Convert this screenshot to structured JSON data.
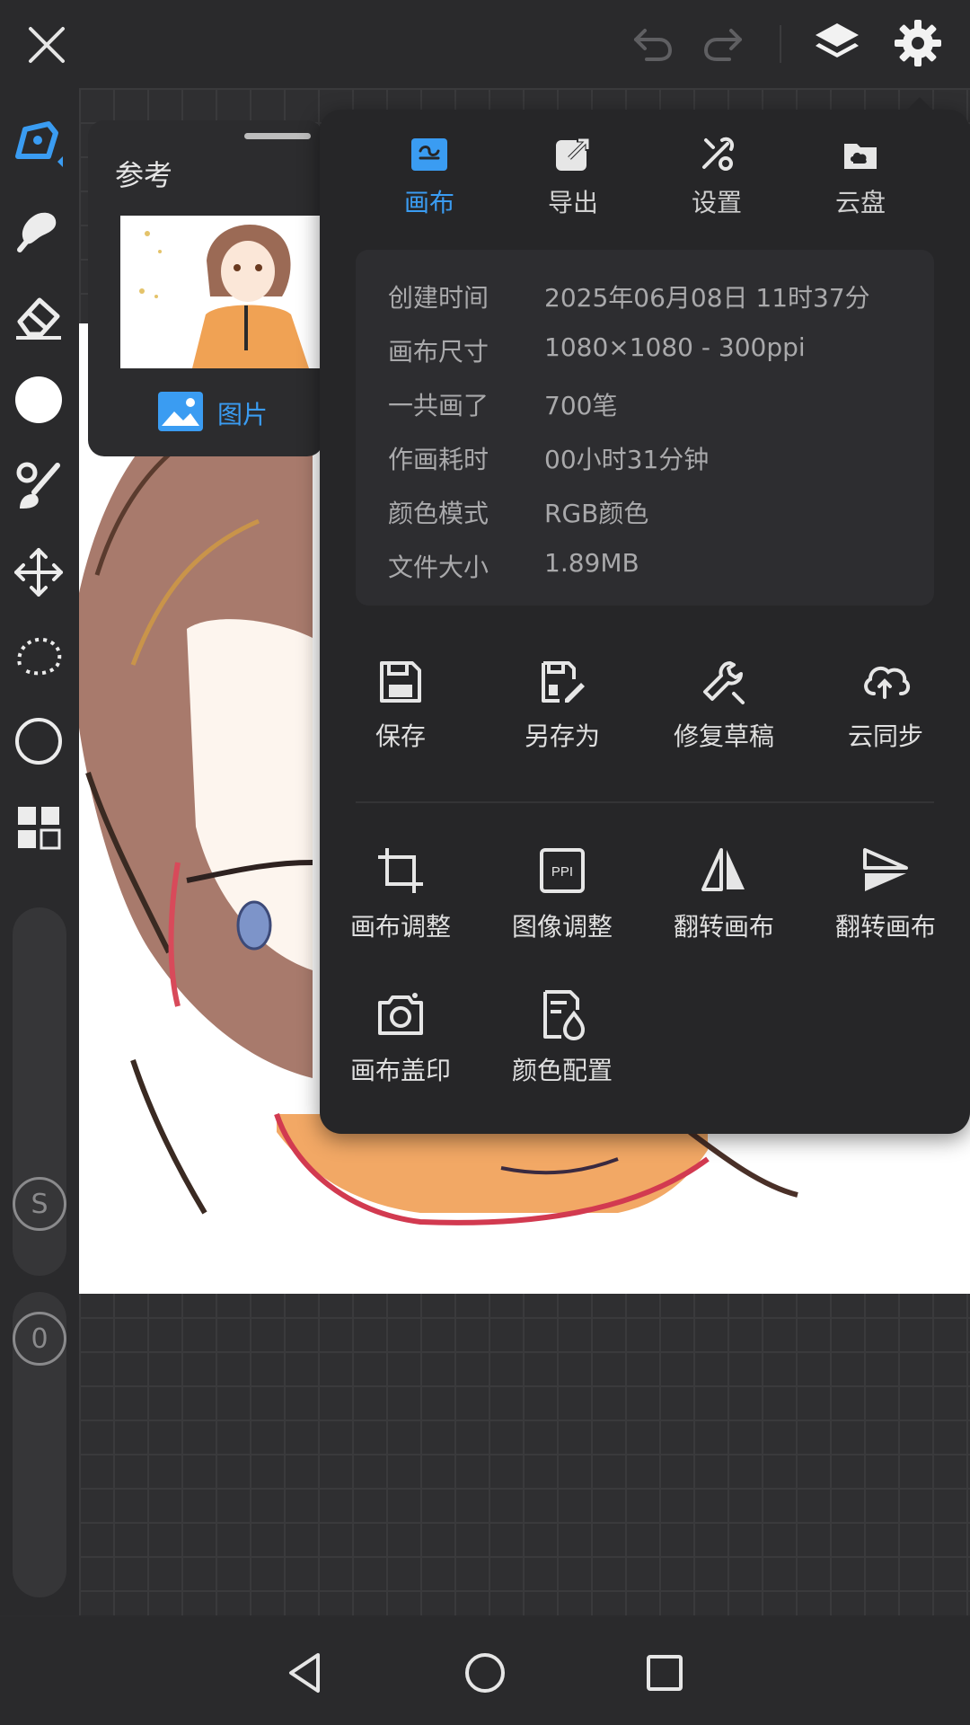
{
  "reference": {
    "title": "参考",
    "image_button_label": "图片"
  },
  "tabs": [
    {
      "label": "画布",
      "icon": "canvas-icon",
      "active": true
    },
    {
      "label": "导出",
      "icon": "export-icon",
      "active": false
    },
    {
      "label": "设置",
      "icon": "tools-icon",
      "active": false
    },
    {
      "label": "云盘",
      "icon": "cloud-drive-icon",
      "active": false
    }
  ],
  "info": [
    {
      "key": "创建时间",
      "value": "2025年06月08日 11时37分"
    },
    {
      "key": "画布尺寸",
      "value": "1080×1080 - 300ppi"
    },
    {
      "key": "一共画了",
      "value": "700笔"
    },
    {
      "key": "作画耗时",
      "value": "00小时31分钟"
    },
    {
      "key": "颜色模式",
      "value": "RGB颜色"
    },
    {
      "key": "文件大小",
      "value": "1.89MB"
    }
  ],
  "actions_row1": [
    {
      "label": "保存",
      "icon": "save-icon"
    },
    {
      "label": "另存为",
      "icon": "save-as-icon"
    },
    {
      "label": "修复草稿",
      "icon": "wrench-icon"
    },
    {
      "label": "云同步",
      "icon": "cloud-sync-icon"
    }
  ],
  "actions_row2": [
    {
      "label": "画布调整",
      "icon": "crop-icon"
    },
    {
      "label": "图像调整",
      "icon": "ppi-icon",
      "icon_text": "PPI"
    },
    {
      "label": "翻转画布",
      "icon": "flip-horizontal-icon"
    },
    {
      "label": "翻转画布",
      "icon": "flip-vertical-icon"
    }
  ],
  "actions_row3": [
    {
      "label": "画布盖印",
      "icon": "camera-icon"
    },
    {
      "label": "颜色配置",
      "icon": "color-profile-icon"
    }
  ],
  "sliders": {
    "size_label": "S",
    "opacity_label": "0"
  },
  "colors": {
    "accent": "#3a9cf2",
    "panel": "#262628",
    "toolbar": "#2a2a2c"
  }
}
